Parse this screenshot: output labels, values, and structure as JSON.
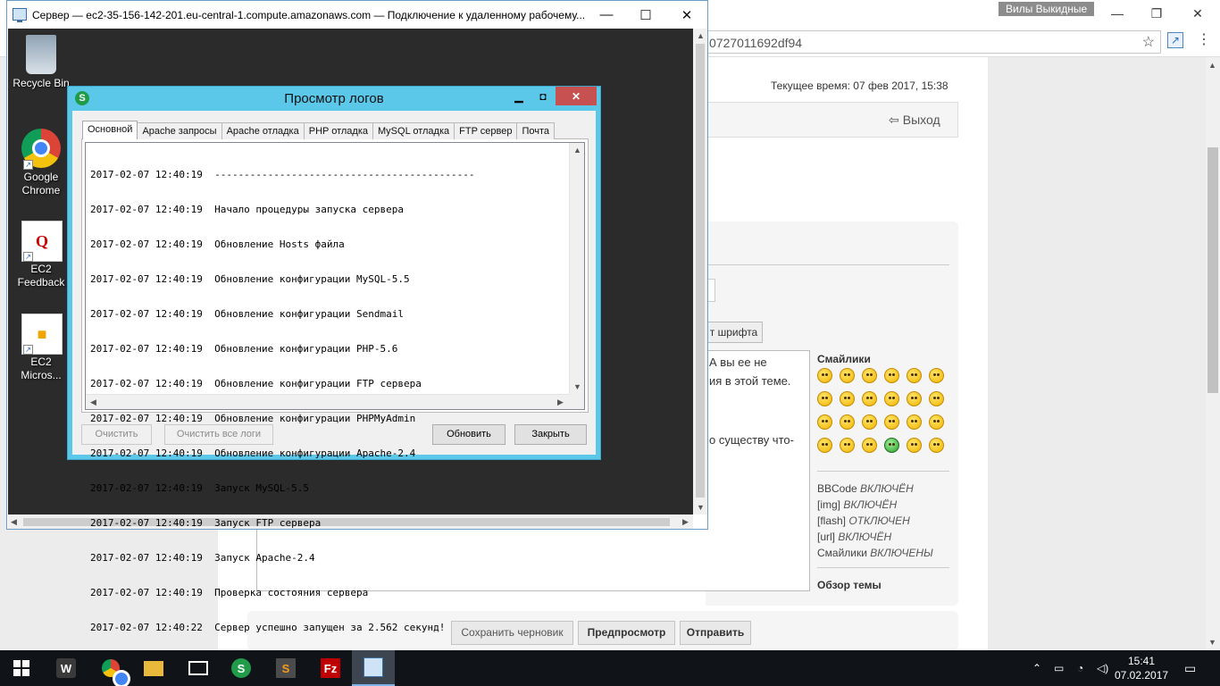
{
  "browser": {
    "profile_name": "Вилы Выкидные",
    "address_fragment": "0727011692df94",
    "menu_icon": "⋮"
  },
  "forum": {
    "current_time": "Текущее время: 07 фев 2017, 15:38",
    "logout": "Выход",
    "font_color_button": "т шрифта",
    "textarea_lines": [
      "А вы ее не",
      "ия в этой теме.",
      "о существу что-"
    ],
    "smilies_title": "Смайлики",
    "options": [
      {
        "label": "BBCode",
        "state": "ВКЛЮЧЁН"
      },
      {
        "label": "[img]",
        "state": "ВКЛЮЧЁН"
      },
      {
        "label": "[flash]",
        "state": "ОТКЛЮЧЕН"
      },
      {
        "label": "[url]",
        "state": "ВКЛЮЧЁН"
      },
      {
        "label": "Смайлики",
        "state": "ВКЛЮЧЕНЫ"
      }
    ],
    "topic_overview": "Обзор темы",
    "buttons": {
      "save_draft": "Сохранить черновик",
      "preview": "Предпросмотр",
      "submit": "Отправить"
    }
  },
  "rdp": {
    "title": "Сервер — ec2-35-156-142-201.eu-central-1.compute.amazonaws.com — Подключение к удаленному рабочему...",
    "desktop_icons": [
      {
        "label": "Recycle Bin",
        "icon": "recycle-bin-icon"
      },
      {
        "label": "Google Chrome",
        "icon": "chrome-icon"
      },
      {
        "label": "EC2 Feedback",
        "icon": "ec2-feedback-icon"
      },
      {
        "label": "EC2 Micros...",
        "icon": "ec2-box-icon"
      }
    ]
  },
  "log_viewer": {
    "title": "Просмотр логов",
    "tabs": [
      "Основной",
      "Apache запросы",
      "Apache отладка",
      "PHP отладка",
      "MySQL отладка",
      "FTP сервер",
      "Почта"
    ],
    "active_tab": "Основной",
    "lines": [
      "2017-02-07 12:40:19  --------------------------------------------",
      "2017-02-07 12:40:19  Начало процедуры запуска сервера",
      "2017-02-07 12:40:19  Обновление Hosts файла",
      "2017-02-07 12:40:19  Обновление конфигурации MySQL-5.5",
      "2017-02-07 12:40:19  Обновление конфигурации Sendmail",
      "2017-02-07 12:40:19  Обновление конфигурации PHP-5.6",
      "2017-02-07 12:40:19  Обновление конфигурации FTP сервера",
      "2017-02-07 12:40:19  Обновление конфигурации PHPMyAdmin",
      "2017-02-07 12:40:19  Обновление конфигурации Apache-2.4",
      "2017-02-07 12:40:19  Запуск MySQL-5.5",
      "2017-02-07 12:40:19  Запуск FTP сервера",
      "2017-02-07 12:40:19  Запуск Apache-2.4",
      "2017-02-07 12:40:19  Проверка состояния сервера",
      "2017-02-07 12:40:22  Сервер успешно запущен за 2.562 секунд!"
    ],
    "buttons": {
      "clear": "Очистить",
      "clear_all": "Очистить все логи",
      "refresh": "Обновить",
      "close": "Закрыть"
    }
  },
  "taskbar": {
    "clock_time": "15:41",
    "clock_date": "07.02.2017"
  }
}
